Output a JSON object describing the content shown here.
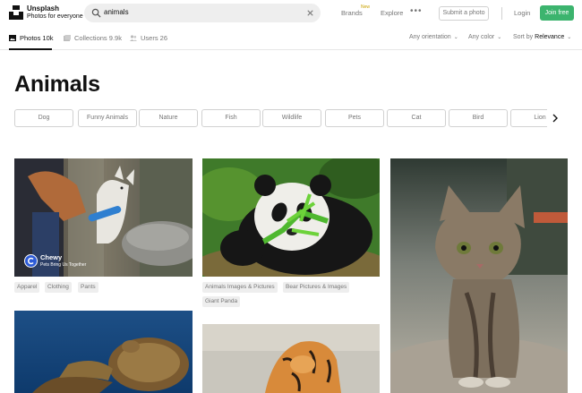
{
  "header": {
    "brand_name": "Unsplash",
    "brand_tagline": "Photos for everyone",
    "search_value": "animals",
    "nav": {
      "brands": "Brands",
      "brands_badge": "New",
      "explore": "Explore",
      "more": "•••"
    },
    "submit_label": "Submit a photo",
    "login_label": "Login",
    "join_label": "Join free"
  },
  "tabs": [
    {
      "label": "Photos 10k",
      "icon": "image-icon",
      "active": true
    },
    {
      "label": "Collections 9.9k",
      "icon": "collection-icon",
      "active": false
    },
    {
      "label": "Users 26",
      "icon": "users-icon",
      "active": false
    }
  ],
  "filters": {
    "orientation": "Any orientation",
    "color": "Any color",
    "sort_prefix": "Sort by",
    "sort_value": "Relevance"
  },
  "page_title": "Animals",
  "related": [
    "Dog",
    "Funny Animals",
    "Nature",
    "Fish",
    "Wildlife",
    "Pets",
    "Cat",
    "Bird",
    "Lion"
  ],
  "photos": {
    "dog": {
      "author_name": "Chewy",
      "author_sub": "Pets Bring Us Together",
      "tags": [
        "Apparel",
        "Clothing",
        "Pants"
      ]
    },
    "panda": {
      "tags": [
        "Animals Images & Pictures",
        "Bear Pictures & Images",
        "Giant Panda"
      ]
    }
  },
  "colors": {
    "accent_green": "#3cb46e",
    "avatar_blue": "#2d5bd7",
    "text_muted": "#767676"
  }
}
